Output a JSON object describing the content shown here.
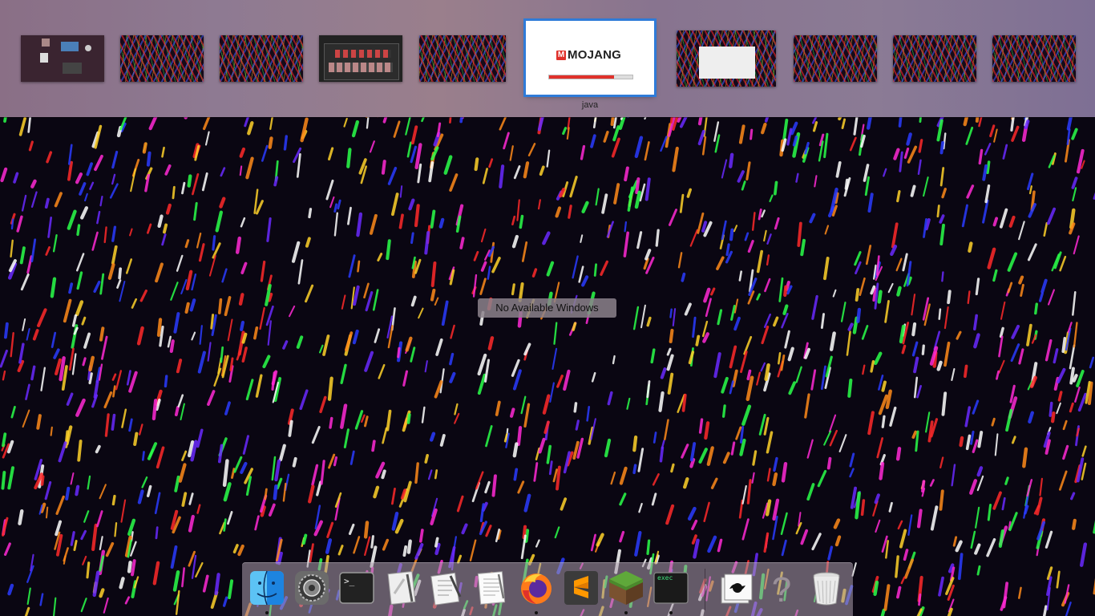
{
  "mission_control": {
    "selected_space_label": "java",
    "selected_window": {
      "brand_mark": "M",
      "brand_name": "MOJANG",
      "progress": 0.78,
      "accent": "#e0312b"
    },
    "highlight_color": "#2f7bd8"
  },
  "desktop": {
    "message": "No Available Windows"
  },
  "dock": {
    "items": [
      {
        "name": "finder",
        "icon": "finder-icon",
        "running": true
      },
      {
        "name": "system-preferences",
        "icon": "gear-icon",
        "running": false
      },
      {
        "name": "terminal",
        "icon": "terminal-icon",
        "running": false
      },
      {
        "name": "script-editor",
        "icon": "script-editor-icon",
        "running": false
      },
      {
        "name": "preview",
        "icon": "preview-icon",
        "running": false
      },
      {
        "name": "textedit",
        "icon": "textedit-icon",
        "running": false
      },
      {
        "name": "firefox",
        "icon": "firefox-icon",
        "running": true
      },
      {
        "name": "sublime-text",
        "icon": "sublime-icon",
        "running": false
      },
      {
        "name": "minecraft",
        "icon": "minecraft-icon",
        "running": true
      },
      {
        "name": "exec",
        "icon": "exec-icon",
        "label": "exec",
        "running": true
      },
      {
        "name": "grapher",
        "icon": "grapher-icon",
        "running": false
      },
      {
        "name": "unknown",
        "icon": "question-icon",
        "running": false
      },
      {
        "name": "trash",
        "icon": "trash-icon",
        "running": false
      }
    ]
  }
}
